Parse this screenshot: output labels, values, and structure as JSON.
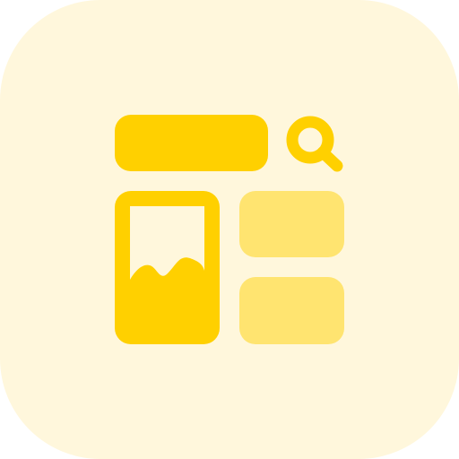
{
  "icon": {
    "name": "web-layout-search-icon",
    "parts": [
      "search-bar",
      "search-icon",
      "image-card",
      "landscape-image",
      "content-block",
      "content-block"
    ]
  },
  "colors": {
    "tile_background": "#FFF7DC",
    "primary": "#FFD000",
    "primary_light": "#FFE470"
  }
}
